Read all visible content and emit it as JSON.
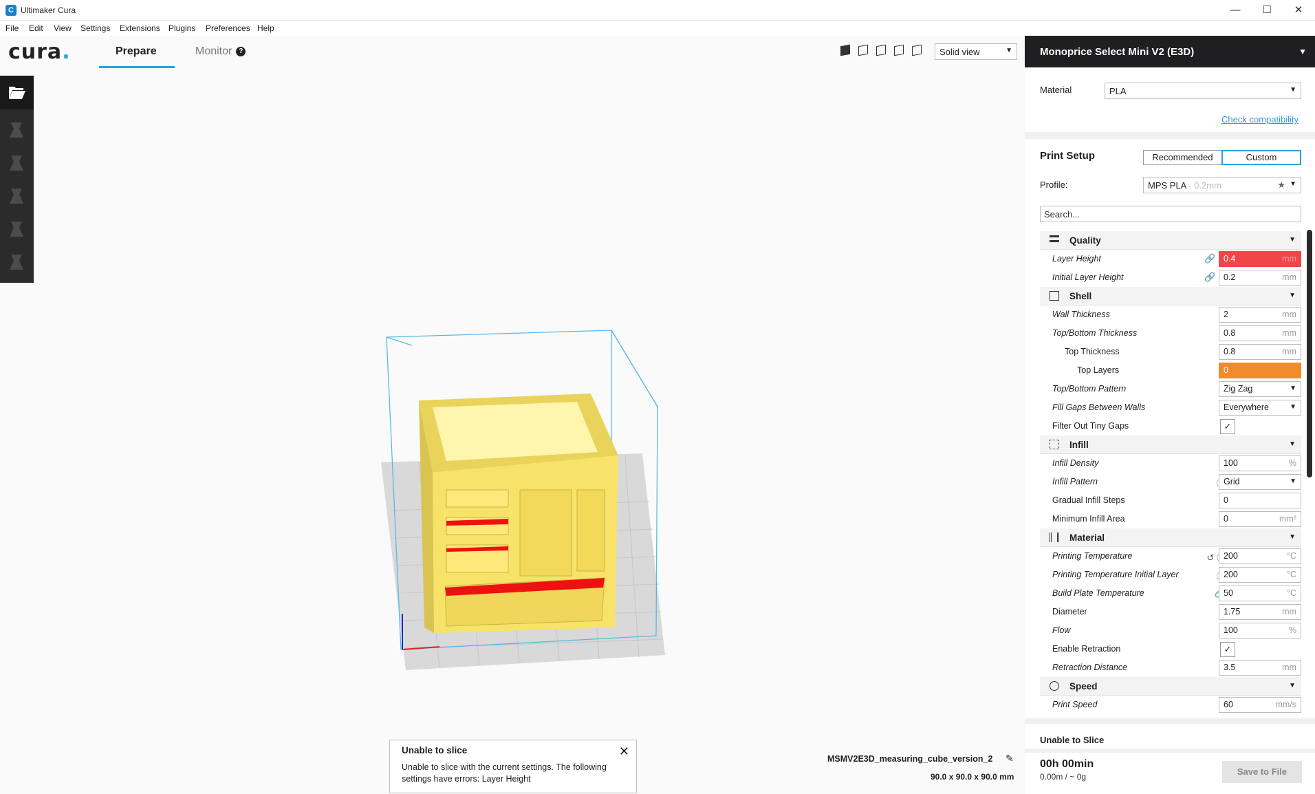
{
  "window": {
    "title": "Ultimaker Cura"
  },
  "menu": [
    "File",
    "Edit",
    "View",
    "Settings",
    "Extensions",
    "Plugins",
    "Preferences",
    "Help"
  ],
  "header": {
    "logo": "cura",
    "tabs": {
      "prepare": "Prepare",
      "monitor": "Monitor"
    },
    "view_mode": "Solid view"
  },
  "printer": {
    "name": "Monoprice Select Mini V2 (E3D)"
  },
  "material": {
    "label": "Material",
    "value": "PLA",
    "compat_link": "Check compatibility"
  },
  "print_setup": {
    "title": "Print Setup",
    "modes": [
      "Recommended",
      "Custom"
    ],
    "active_mode": "Custom",
    "profile_label": "Profile:",
    "profile_value": "MPS PLA",
    "profile_hint": "- 0.2mm",
    "search_placeholder": "Search..."
  },
  "categories": {
    "quality": "Quality",
    "shell": "Shell",
    "infill": "Infill",
    "material": "Material",
    "speed": "Speed"
  },
  "settings": {
    "layer_height": {
      "name": "Layer Height",
      "value": "0.4",
      "unit": "mm"
    },
    "initial_layer_height": {
      "name": "Initial Layer Height",
      "value": "0.2",
      "unit": "mm"
    },
    "wall_thickness": {
      "name": "Wall Thickness",
      "value": "2",
      "unit": "mm"
    },
    "topbottom_thickness": {
      "name": "Top/Bottom Thickness",
      "value": "0.8",
      "unit": "mm"
    },
    "top_thickness": {
      "name": "Top Thickness",
      "value": "0.8",
      "unit": "mm"
    },
    "top_layers": {
      "name": "Top Layers",
      "value": "0",
      "unit": ""
    },
    "topbottom_pattern": {
      "name": "Top/Bottom Pattern",
      "value": "Zig Zag"
    },
    "fill_gaps": {
      "name": "Fill Gaps Between Walls",
      "value": "Everywhere"
    },
    "filter_tiny_gaps": {
      "name": "Filter Out Tiny Gaps",
      "checked": "✓"
    },
    "infill_density": {
      "name": "Infill Density",
      "value": "100",
      "unit": "%"
    },
    "infill_pattern": {
      "name": "Infill Pattern",
      "value": "Grid"
    },
    "gradual_infill": {
      "name": "Gradual Infill Steps",
      "value": "0",
      "unit": ""
    },
    "min_infill_area": {
      "name": "Minimum Infill Area",
      "value": "0",
      "unit": "mm²"
    },
    "print_temp": {
      "name": "Printing Temperature",
      "value": "200",
      "unit": "°C"
    },
    "print_temp_initial": {
      "name": "Printing Temperature Initial Layer",
      "value": "200",
      "unit": "°C"
    },
    "bed_temp": {
      "name": "Build Plate Temperature",
      "value": "50",
      "unit": "°C"
    },
    "diameter": {
      "name": "Diameter",
      "value": "1.75",
      "unit": "mm"
    },
    "flow": {
      "name": "Flow",
      "value": "100",
      "unit": "%"
    },
    "enable_retraction": {
      "name": "Enable Retraction",
      "checked": "✓"
    },
    "retraction_distance": {
      "name": "Retraction Distance",
      "value": "3.5",
      "unit": "mm"
    },
    "print_speed": {
      "name": "Print Speed",
      "value": "60",
      "unit": "mm/s"
    }
  },
  "bottom": {
    "status": "Unable to Slice",
    "time": "00h 00min",
    "material_usage": "0.00m / ~ 0g",
    "save_button": "Save to File"
  },
  "toast": {
    "title": "Unable to slice",
    "body": "Unable to slice with the current settings. The following settings have errors: Layer Height"
  },
  "job": {
    "name": "MSMV2E3D_measuring_cube_version_2",
    "dimensions": "90.0 x 90.0 x 90.0 mm"
  },
  "colors": {
    "accent": "#2aa1dc",
    "error": "#f2454a",
    "warning": "#f28b2c",
    "model": "#f7e36a"
  }
}
